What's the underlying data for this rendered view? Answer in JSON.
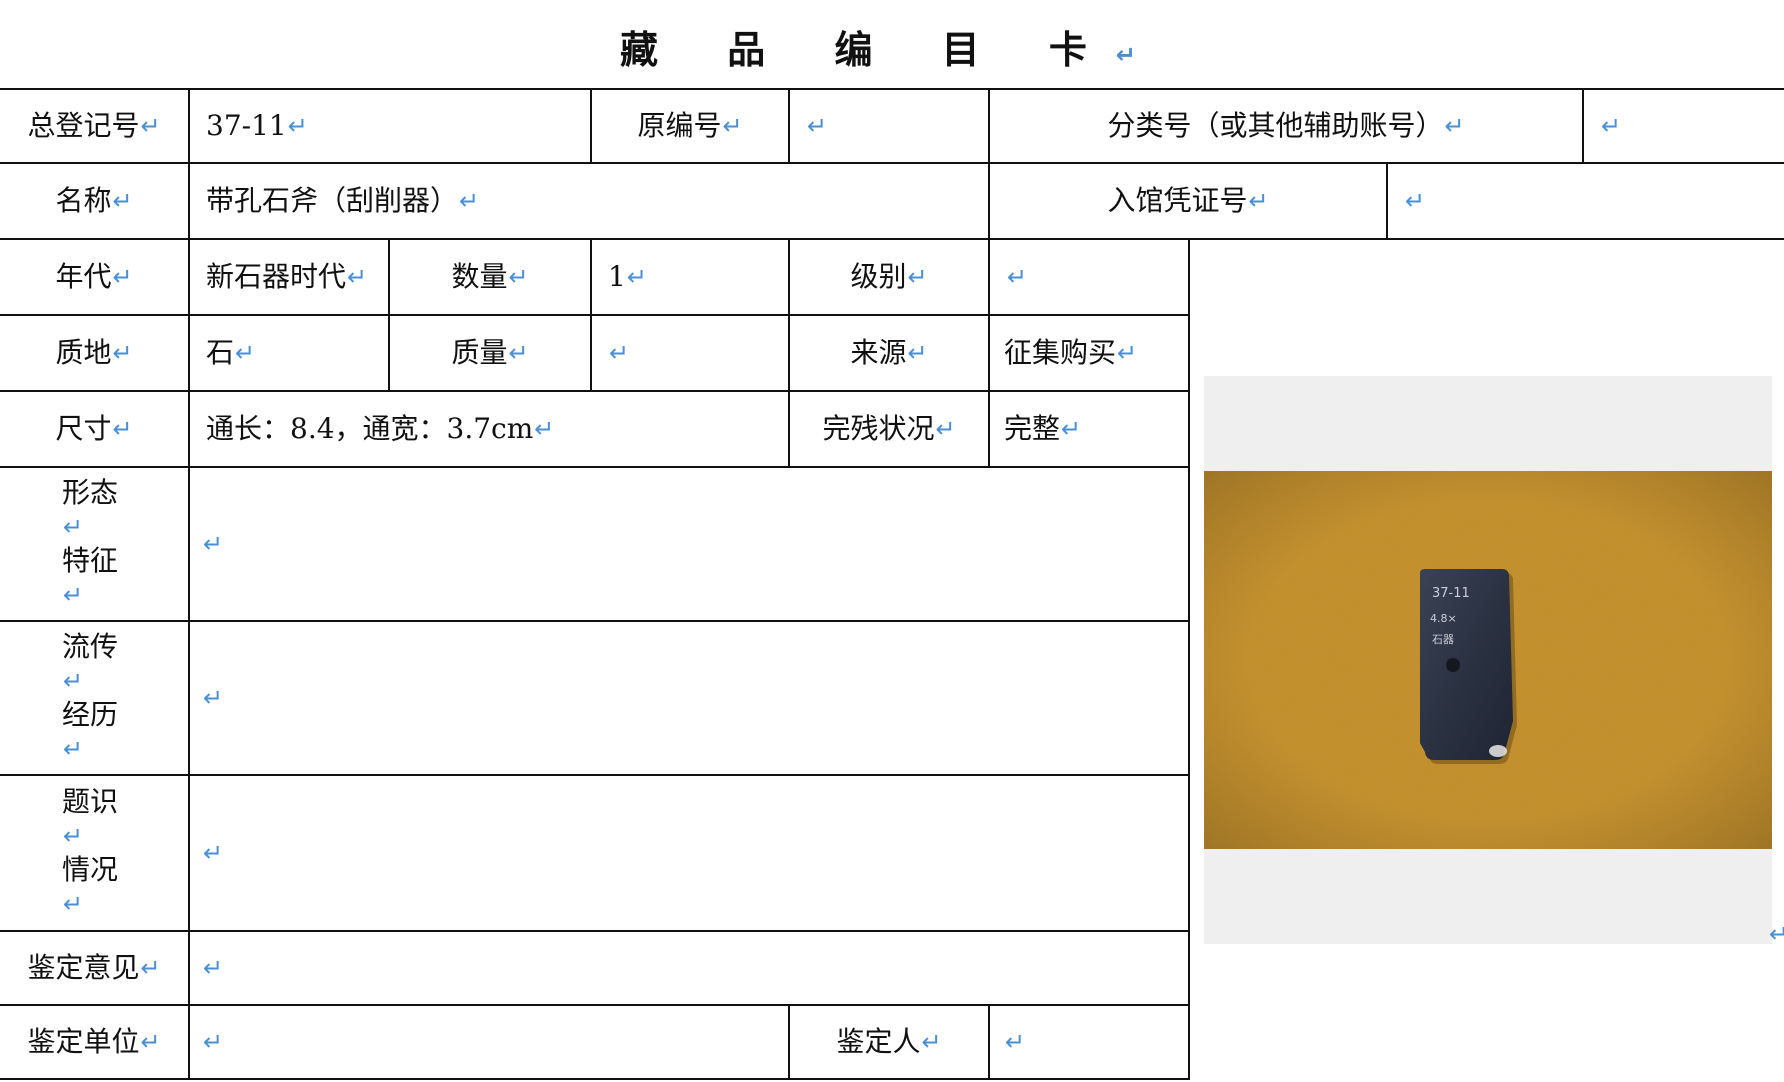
{
  "title": "藏 品 编 目 卡",
  "return_mark": "↵",
  "fields": {
    "registration_no_label": "总登记号",
    "registration_no_value": "37-11",
    "original_no_label": "原编号",
    "original_no_value": "",
    "classification_label": "分类号（或其他辅助账号）",
    "classification_value": "",
    "name_label": "名称",
    "name_value": "带孔石斧（刮削器）",
    "entry_voucher_label": "入馆凭证号",
    "entry_voucher_value": "",
    "era_label": "年代",
    "era_value": "新石器时代",
    "quantity_label": "数量",
    "quantity_value": "1",
    "grade_label": "级别",
    "grade_value": "",
    "material_label": "质地",
    "material_value": "石",
    "weight_label": "质量",
    "weight_value": "",
    "source_label": "来源",
    "source_value": "征集购买",
    "size_label": "尺寸",
    "size_value": "通长：8.4，通宽：3.7cm",
    "condition_label": "完残状况",
    "condition_value": "完整",
    "form_label_1": "形态",
    "form_label_2": "特征",
    "form_value": "",
    "history_label_1": "流传",
    "history_label_2": "经历",
    "history_value": "",
    "inscription_label_1": "题识",
    "inscription_label_2": "情况",
    "inscription_value": "",
    "appraisal_opinion_label": "鉴定意见",
    "appraisal_opinion_value": "",
    "appraisal_unit_label": "鉴定单位",
    "appraisal_unit_value": "",
    "appraiser_label": "鉴定人",
    "appraiser_value": ""
  },
  "photo": {
    "backdrop_color": "#c8922f",
    "object_color": "#2b3242",
    "object_inscription": [
      "37-11",
      "4.8×",
      "石器"
    ]
  }
}
